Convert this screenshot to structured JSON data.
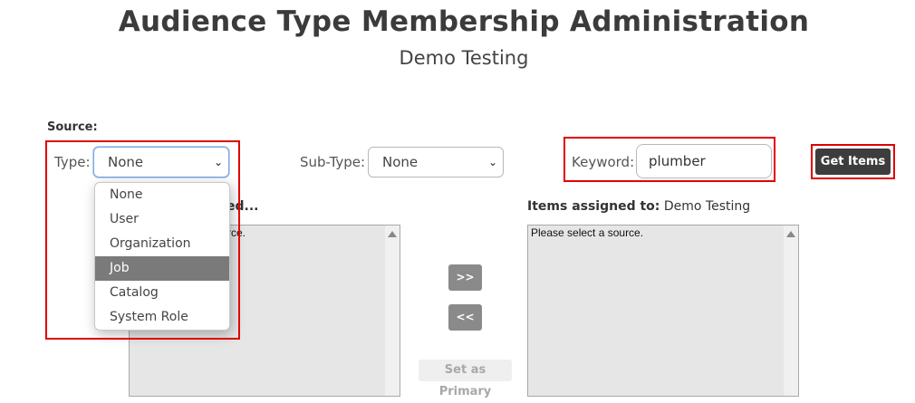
{
  "header": {
    "title": "Audience Type Membership Administration",
    "subtitle": "Demo Testing"
  },
  "source": {
    "label": "Source:",
    "type_label": "Type:",
    "type_value": "None",
    "type_options": [
      "None",
      "User",
      "Organization",
      "Job",
      "Catalog",
      "System Role"
    ],
    "type_highlighted": "Job",
    "subtype_label": "Sub-Type:",
    "subtype_value": "None",
    "keyword_label": "Keyword:",
    "keyword_value": "plumber",
    "get_items_label": "Get Items"
  },
  "available": {
    "header_partial": "ed...",
    "placeholder_partial": "rce."
  },
  "actions": {
    "add_label": ">>",
    "remove_label": "<<",
    "set_primary_label": "Set as Primary"
  },
  "assigned": {
    "header_label": "Items assigned to:",
    "header_value": "Demo Testing",
    "placeholder": "Please select a source."
  },
  "colors": {
    "highlight_box": "#e00000",
    "dark_button": "#3d3d3d",
    "selected_option": "#7a7a7a",
    "listbox_bg": "#e6e6e6"
  }
}
